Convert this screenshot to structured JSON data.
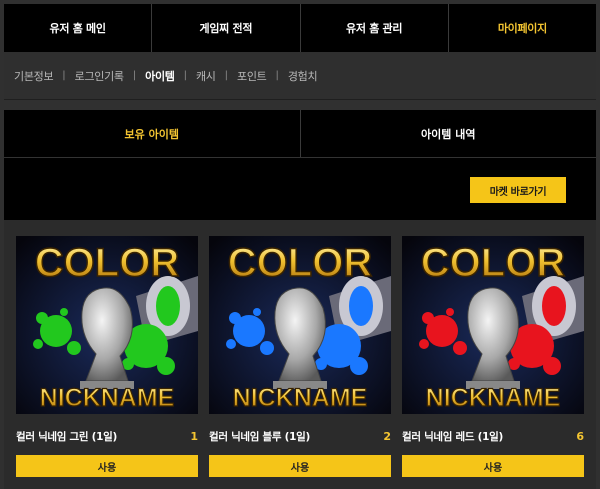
{
  "topnav": {
    "tabs": [
      {
        "label": "유저 홈 메인"
      },
      {
        "label": "게임찌 전적"
      },
      {
        "label": "유저 홈 관리"
      },
      {
        "label": "마이페이지"
      }
    ]
  },
  "subnav": {
    "items": [
      {
        "label": "기본정보"
      },
      {
        "label": "로그인기록"
      },
      {
        "label": "아이템"
      },
      {
        "label": "캐시"
      },
      {
        "label": "포인트"
      },
      {
        "label": "경험치"
      }
    ],
    "separator": "|"
  },
  "content_tabs": {
    "owned": "보유 아이템",
    "history": "아이템 내역"
  },
  "market_button": "마켓 바로가기",
  "items": [
    {
      "name": "컬러 닉네임 그린 (1일)",
      "count": "1",
      "use_label": "사용",
      "thumb_title": "COLOR",
      "thumb_sub": "NICKNAME",
      "accent": "#22c81e"
    },
    {
      "name": "컬러 닉네임 블루 (1일)",
      "count": "2",
      "use_label": "사용",
      "thumb_title": "COLOR",
      "thumb_sub": "NICKNAME",
      "accent": "#1a78ff"
    },
    {
      "name": "컬러 닉네임 레드 (1일)",
      "count": "6",
      "use_label": "사용",
      "thumb_title": "COLOR",
      "thumb_sub": "NICKNAME",
      "accent": "#e8141e"
    }
  ],
  "colors": {
    "accent_gold": "#f4c531",
    "button_yellow": "#f5c518"
  }
}
